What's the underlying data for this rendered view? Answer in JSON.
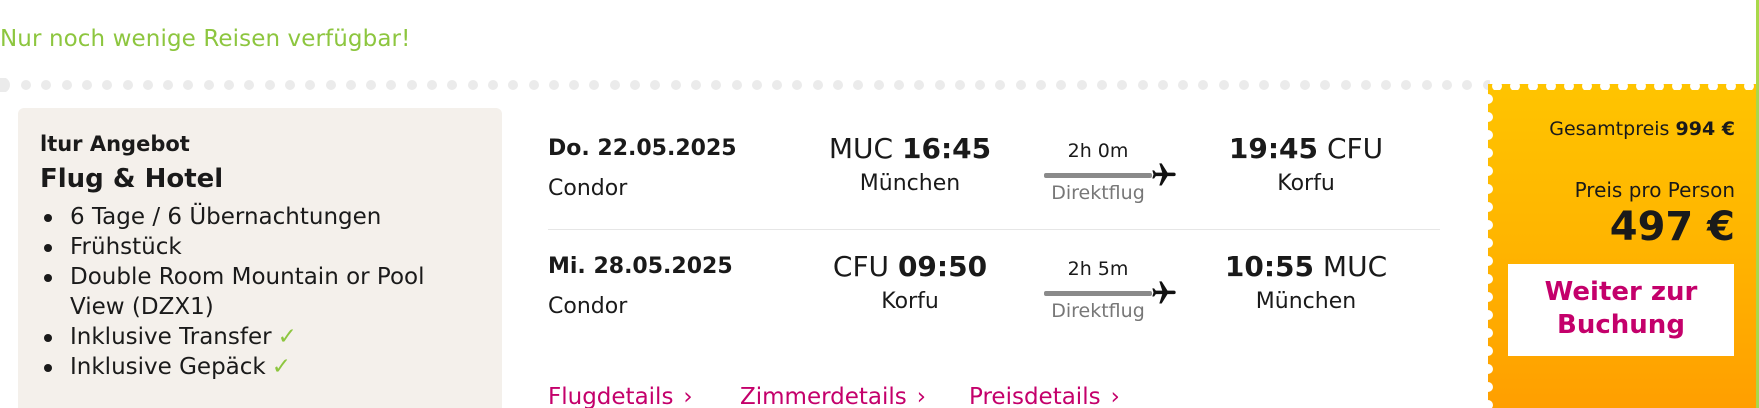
{
  "availability": "Nur noch wenige Reisen verfügbar!",
  "offer": {
    "brand": "ltur Angebot",
    "title": "Flug & Hotel",
    "items": [
      {
        "text": "6 Tage / 6 Übernachtungen",
        "check": ""
      },
      {
        "text": "Frühstück",
        "check": ""
      },
      {
        "text": "Double Room Mountain or Pool View (DZX1)",
        "check": ""
      },
      {
        "text": "Inklusive Transfer",
        "check": "✓"
      },
      {
        "text": "Inklusive Gepäck",
        "check": "✓"
      }
    ]
  },
  "flights": {
    "outbound": {
      "date": "Do. 22.05.2025",
      "airline": "Condor",
      "dep_code": "MUC",
      "dep_time": "16:45",
      "dep_city": "München",
      "duration": "2h 0m",
      "type": "Direktflug",
      "arr_time": "19:45",
      "arr_code": "CFU",
      "arr_city": "Korfu"
    },
    "return": {
      "date": "Mi. 28.05.2025",
      "airline": "Condor",
      "dep_code": "CFU",
      "dep_time": "09:50",
      "dep_city": "Korfu",
      "duration": "2h 5m",
      "type": "Direktflug",
      "arr_time": "10:55",
      "arr_code": "MUC",
      "arr_city": "München"
    }
  },
  "links": {
    "flight": "Flugdetails",
    "room": "Zimmerdetails",
    "price": "Preisdetails",
    "chevron": "›"
  },
  "price": {
    "total_label": "Gesamtpreis",
    "total_value": "994 €",
    "per_person_label": "Preis pro Person",
    "per_person_value": "497 €",
    "button_label": "Weiter zur Buchung"
  },
  "colors": {
    "accent": "#c4006b",
    "availability": "#8dc63f",
    "panel": "#ffb400"
  },
  "icons": {
    "flight": "plane-icon",
    "links": "chevron-right-icon",
    "included": "check-icon"
  }
}
